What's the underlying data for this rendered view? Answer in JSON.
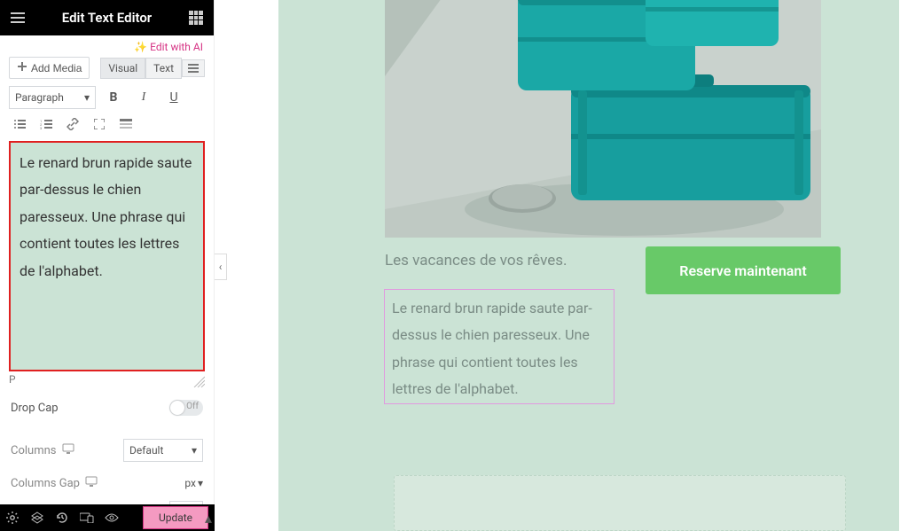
{
  "panel": {
    "title": "Edit Text Editor",
    "ai_label": "✨ Edit with AI",
    "add_media": "Add Media",
    "tabs": {
      "visual": "Visual",
      "text": "Text"
    },
    "format": {
      "paragraph": "Paragraph",
      "bold": "B",
      "italic": "I",
      "underline": "U"
    },
    "content": "Le renard brun rapide saute par-dessus le chien paresseux. Une phrase qui contient toutes les lettres de l'alphabet.",
    "path": "P",
    "drop_cap": {
      "label": "Drop Cap",
      "state": "Off"
    },
    "columns": {
      "label": "Columns",
      "value": "Default"
    },
    "columns_gap": {
      "label": "Columns Gap",
      "unit": "px"
    },
    "update": "Update"
  },
  "preview": {
    "caption": "Les vacances de vos rêves.",
    "selected_text": "Le renard brun rapide saute par-dessus le chien paresseux. Une phrase qui contient toutes les lettres de l'alphabet.",
    "cta": "Reserve maintenant"
  }
}
